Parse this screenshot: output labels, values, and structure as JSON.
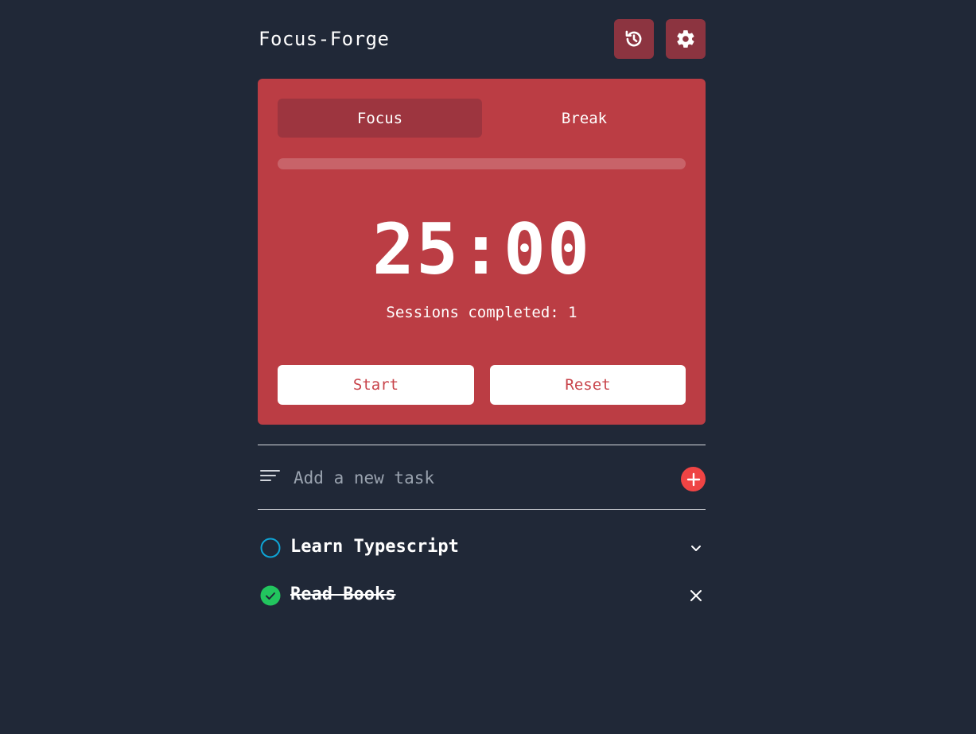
{
  "header": {
    "title": "Focus-Forge",
    "history_icon": "history-icon",
    "settings_icon": "gear-icon"
  },
  "timer_card": {
    "tabs": [
      {
        "label": "Focus",
        "active": true
      },
      {
        "label": "Break",
        "active": false
      }
    ],
    "progress_fraction": 0,
    "time": "25:00",
    "sessions_text": "Sessions completed: 1",
    "start_label": "Start",
    "reset_label": "Reset"
  },
  "task_input": {
    "placeholder": "Add a new task",
    "value": "",
    "filter_icon": "sort-lines-icon",
    "add_icon": "plus-circle-icon"
  },
  "tasks": [
    {
      "label": "Learn Typescript",
      "completed": false,
      "action_icon": "chevron-down-icon"
    },
    {
      "label": "Read Books",
      "completed": true,
      "action_icon": "close-icon"
    }
  ],
  "colors": {
    "background": "#202837",
    "card": "#bb3d44",
    "active_tab": "#9d353f",
    "icon_button": "#8c3440",
    "accent_red": "#ef4444",
    "pending_circle": "#0ea5d6",
    "done_check": "#22c55e"
  }
}
